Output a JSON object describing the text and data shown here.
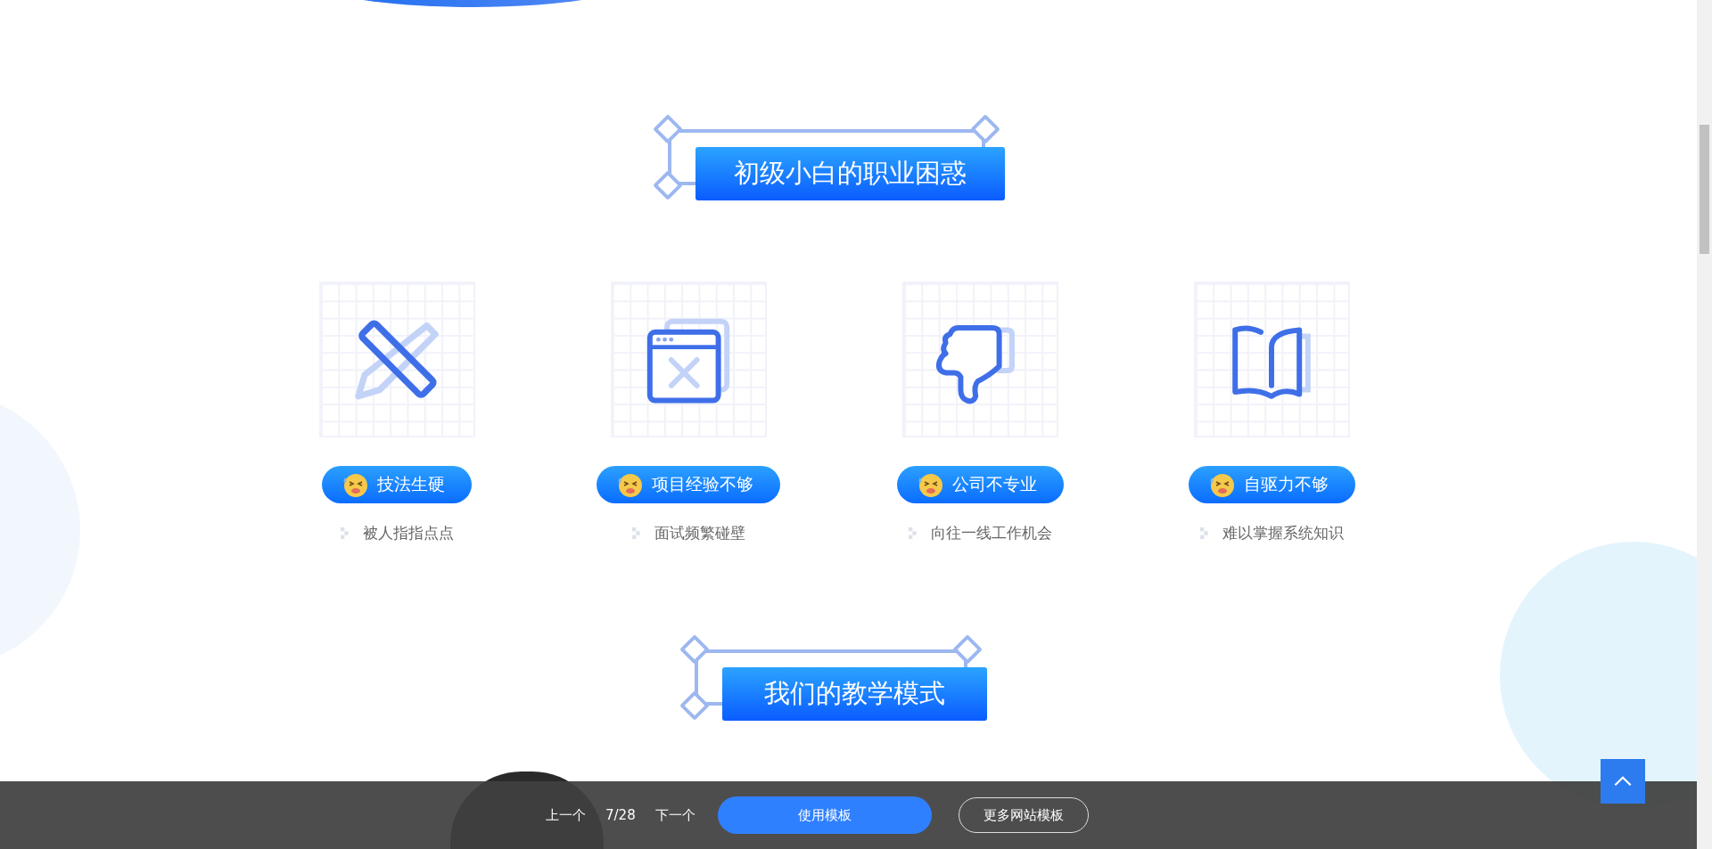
{
  "sections": [
    {
      "title": "初级小白的职业困惑"
    },
    {
      "title": "我们的教学模式"
    }
  ],
  "problems": [
    {
      "title": "技法生硬",
      "note": "被人指指点点"
    },
    {
      "title": "项目经验不够",
      "note": "面试频繁碰壁"
    },
    {
      "title": "公司不专业",
      "note": "向往一线工作机会"
    },
    {
      "title": "自驱力不够",
      "note": "难以掌握系统知识"
    }
  ],
  "bottom_bar": {
    "prev": "上一个",
    "page": "7/28",
    "next": "下一个",
    "use_button": "使用模板",
    "more_button": "更多网站模板"
  }
}
